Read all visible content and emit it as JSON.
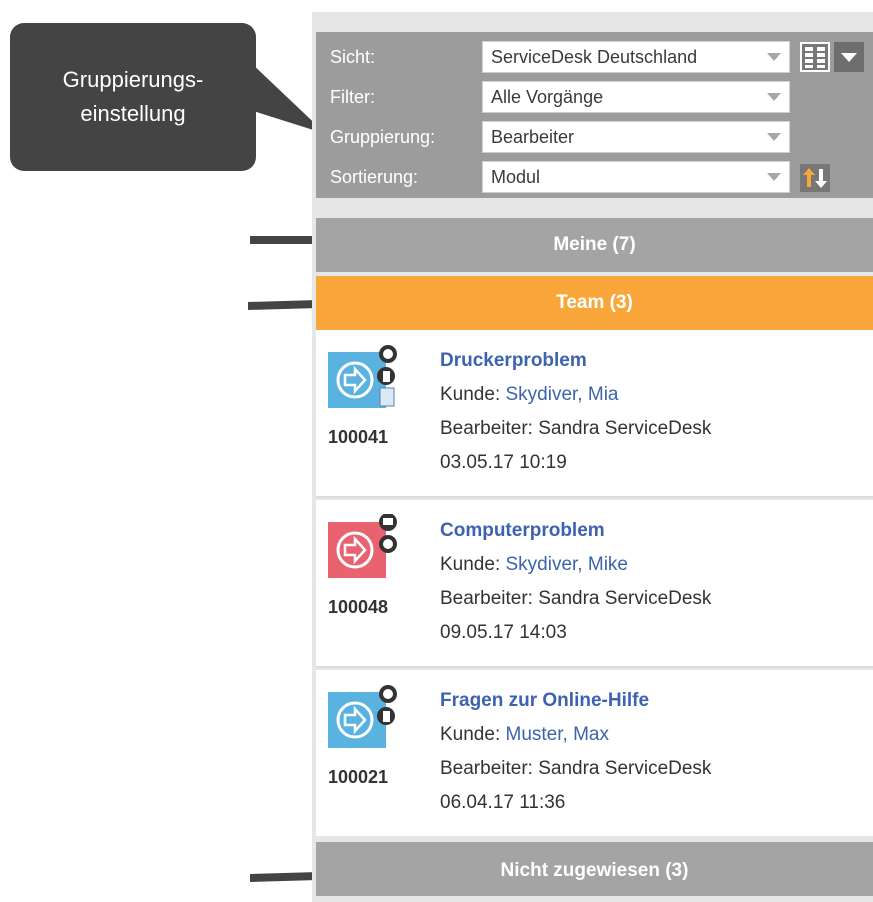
{
  "callout": {
    "line1": "Gruppierungs-",
    "line2": "einstellung"
  },
  "settings": {
    "rows": [
      {
        "label": "Sicht:",
        "value": "ServiceDesk Deutschland"
      },
      {
        "label": "Filter:",
        "value": "Alle Vorgänge"
      },
      {
        "label": "Gruppierung:",
        "value": "Bearbeiter"
      },
      {
        "label": "Sortierung:",
        "value": "Modul"
      }
    ],
    "sort_icon": "sort-up-down-arrows-icon",
    "grid_icon": "column-layout-icon"
  },
  "groups": {
    "meine": "Meine (7)",
    "team": "Team (3)",
    "nicht": "Nicht zugewiesen (3)"
  },
  "labels": {
    "kunde": "Kunde: ",
    "bearbeiter": "Bearbeiter: "
  },
  "tickets": [
    {
      "id": "100041",
      "title": "Druckerproblem",
      "kunde": "Skydiver, Mia",
      "bearbeiter": "Sandra ServiceDesk",
      "date": "03.05.17 10:19",
      "color": "#5ab2e0"
    },
    {
      "id": "100048",
      "title": "Computerproblem",
      "kunde": "Skydiver, Mike",
      "bearbeiter": "Sandra ServiceDesk",
      "date": "09.05.17 14:03",
      "color": "#e8636f"
    },
    {
      "id": "100021",
      "title": "Fragen zur Online-Hilfe",
      "kunde": "Muster, Max",
      "bearbeiter": "Sandra ServiceDesk",
      "date": "06.04.17 11:36",
      "color": "#5ab2e0"
    }
  ],
  "colors": {
    "accent_orange": "#f9a63a",
    "link_blue": "#3d63ae",
    "group_gray": "#a4a4a4"
  }
}
